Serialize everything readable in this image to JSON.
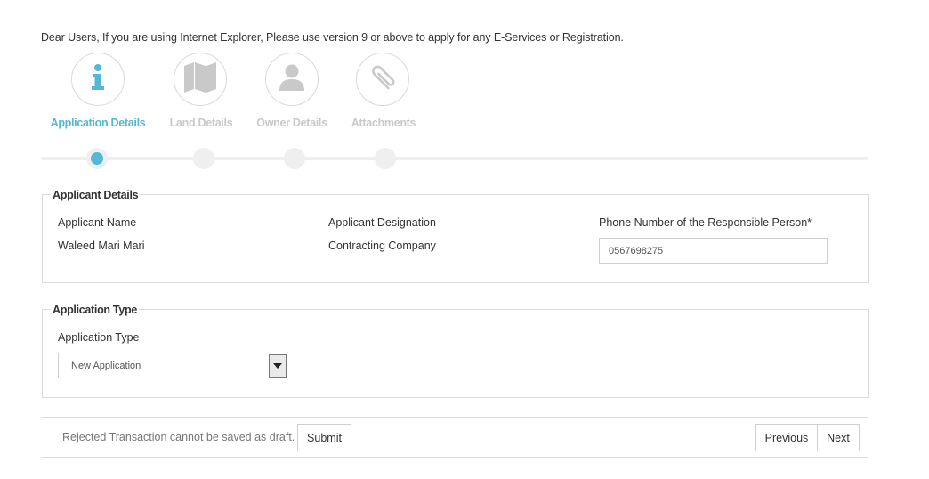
{
  "notice": "Dear Users, If you are using Internet Explorer, Please use version 9 or above to apply for any E-Services or Registration.",
  "steps": [
    {
      "label": "Application Details",
      "icon": "info-icon",
      "active": true
    },
    {
      "label": "Land Details",
      "icon": "map-icon",
      "active": false
    },
    {
      "label": "Owner Details",
      "icon": "user-icon",
      "active": false
    },
    {
      "label": "Attachments",
      "icon": "paperclip-icon",
      "active": false
    }
  ],
  "colors": {
    "accent": "#52b8d6",
    "inactive": "#c9c9c9",
    "border": "#dcdcdc"
  },
  "applicant_details": {
    "title": "Applicant Details",
    "name_label": "Applicant Name",
    "name_value": "Waleed Mari Mari",
    "designation_label": "Applicant Designation",
    "designation_value": "Contracting Company",
    "phone_label": "Phone Number of the Responsible Person*",
    "phone_value": "0567698275"
  },
  "application_type": {
    "title": "Application Type",
    "field_label": "Application Type",
    "selected": "New Application"
  },
  "footer": {
    "note": "Rejected Transaction cannot be saved as draft.",
    "submit_label": "Submit",
    "previous_label": "Previous",
    "next_label": "Next"
  }
}
